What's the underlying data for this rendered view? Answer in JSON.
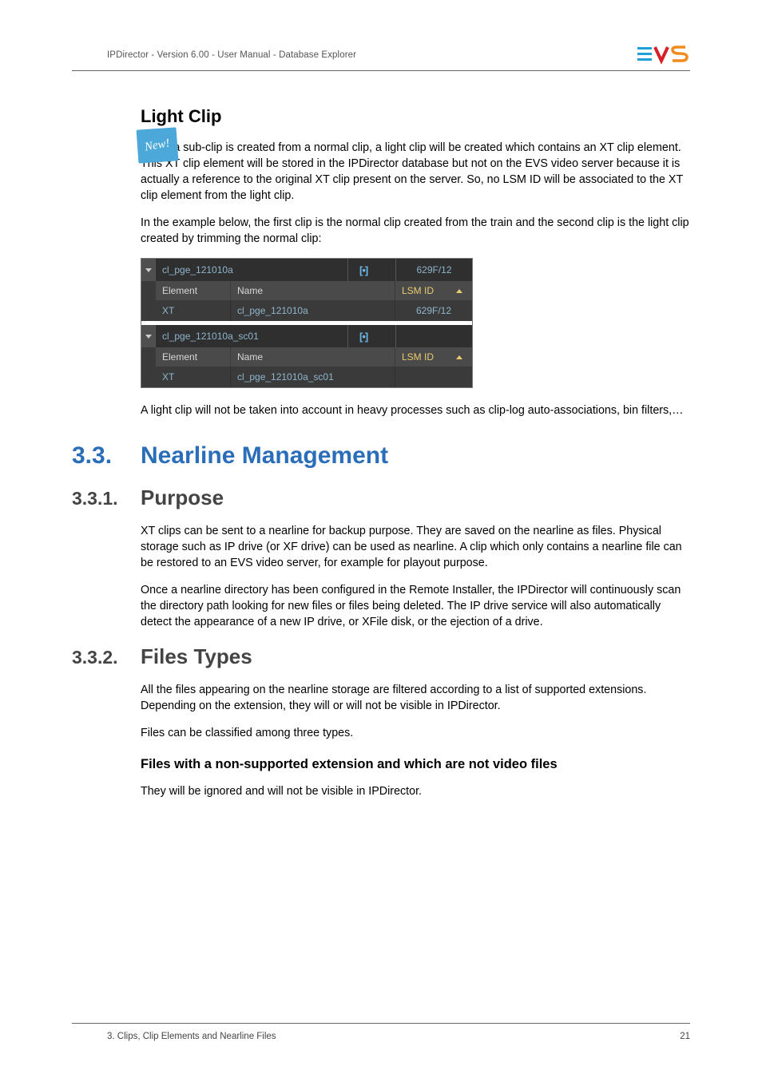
{
  "header": {
    "breadcrumb": "IPDirector - Version 6.00 - User Manual - Database Explorer"
  },
  "new_badge": "New!",
  "section_light_clip": {
    "title": "Light Clip",
    "p1": "When a sub-clip is created from a normal clip, a light clip will be created which contains an XT clip element. This XT clip element will be stored in the IPDirector database but not on the EVS video server because it is actually a reference to the original XT clip present on the server. So, no LSM ID will be associated to the XT clip element from the light clip.",
    "p2": "In the example below, the first clip is the normal clip created from the train and the second clip is the light clip created by trimming the normal clip:",
    "p3": "A light clip will not be taken into account in heavy processes such as clip-log auto-associations, bin filters,…"
  },
  "screenshot": {
    "clip1": {
      "name": "cl_pge_121010a",
      "lsm": "629F/12"
    },
    "headers": {
      "element": "Element",
      "name": "Name",
      "lsmid": "LSM ID"
    },
    "row1": {
      "element": "XT",
      "name": "cl_pge_121010a",
      "lsm": "629F/12"
    },
    "clip2": {
      "name": "cl_pge_121010a_sc01",
      "lsm": ""
    },
    "row2": {
      "element": "XT",
      "name": "cl_pge_121010a_sc01",
      "lsm": ""
    }
  },
  "section_33": {
    "num": "3.3.",
    "title": "Nearline Management"
  },
  "section_331": {
    "num": "3.3.1.",
    "title": "Purpose",
    "p1": "XT clips can be sent to a nearline for backup purpose. They are saved on the nearline as files. Physical storage such as IP drive (or XF drive) can be used as nearline. A clip which only contains a nearline file can be restored to an EVS video server, for example for playout purpose.",
    "p2": "Once a nearline directory has been configured in the Remote Installer, the IPDirector will continuously scan the directory path looking for new files or files being deleted. The IP drive service will also automatically detect the appearance of a new IP drive, or XFile disk, or the ejection of a drive."
  },
  "section_332": {
    "num": "3.3.2.",
    "title": "Files Types",
    "p1": "All the files appearing on the nearline storage are filtered according to a list of supported extensions. Depending on the extension, they will or will not be visible in IPDirector.",
    "p2": "Files can be classified among three types.",
    "sub_title": "Files with a non-supported extension and which are not video files",
    "sub_p": "They will be ignored and will not be visible in IPDirector."
  },
  "footer": {
    "left": "3. Clips, Clip Elements and Nearline Files",
    "right": "21"
  }
}
